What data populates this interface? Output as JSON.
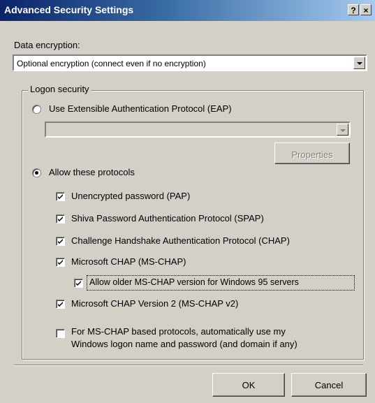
{
  "window": {
    "title": "Advanced Security Settings",
    "help_icon": "?",
    "close_icon": "×"
  },
  "encryption": {
    "label": "Data encryption:",
    "selected": "Optional encryption (connect even if no encryption)"
  },
  "logon": {
    "group_label": "Logon security",
    "eap_radio_label": "Use Extensible Authentication Protocol (EAP)",
    "eap_selected": "",
    "properties_label": "Properties",
    "allow_radio_label": "Allow these protocols",
    "protocols": [
      "Unencrypted password (PAP)",
      "Shiva Password Authentication Protocol (SPAP)",
      "Challenge Handshake Authentication Protocol (CHAP)",
      "Microsoft CHAP (MS-CHAP)",
      "Allow older MS-CHAP version for Windows 95 servers",
      "Microsoft CHAP Version 2 (MS-CHAP v2)"
    ],
    "auto_logon_line1": "For MS-CHAP based protocols, automatically use my",
    "auto_logon_line2": "Windows logon name and password (and domain if any)"
  },
  "buttons": {
    "ok": "OK",
    "cancel": "Cancel"
  }
}
